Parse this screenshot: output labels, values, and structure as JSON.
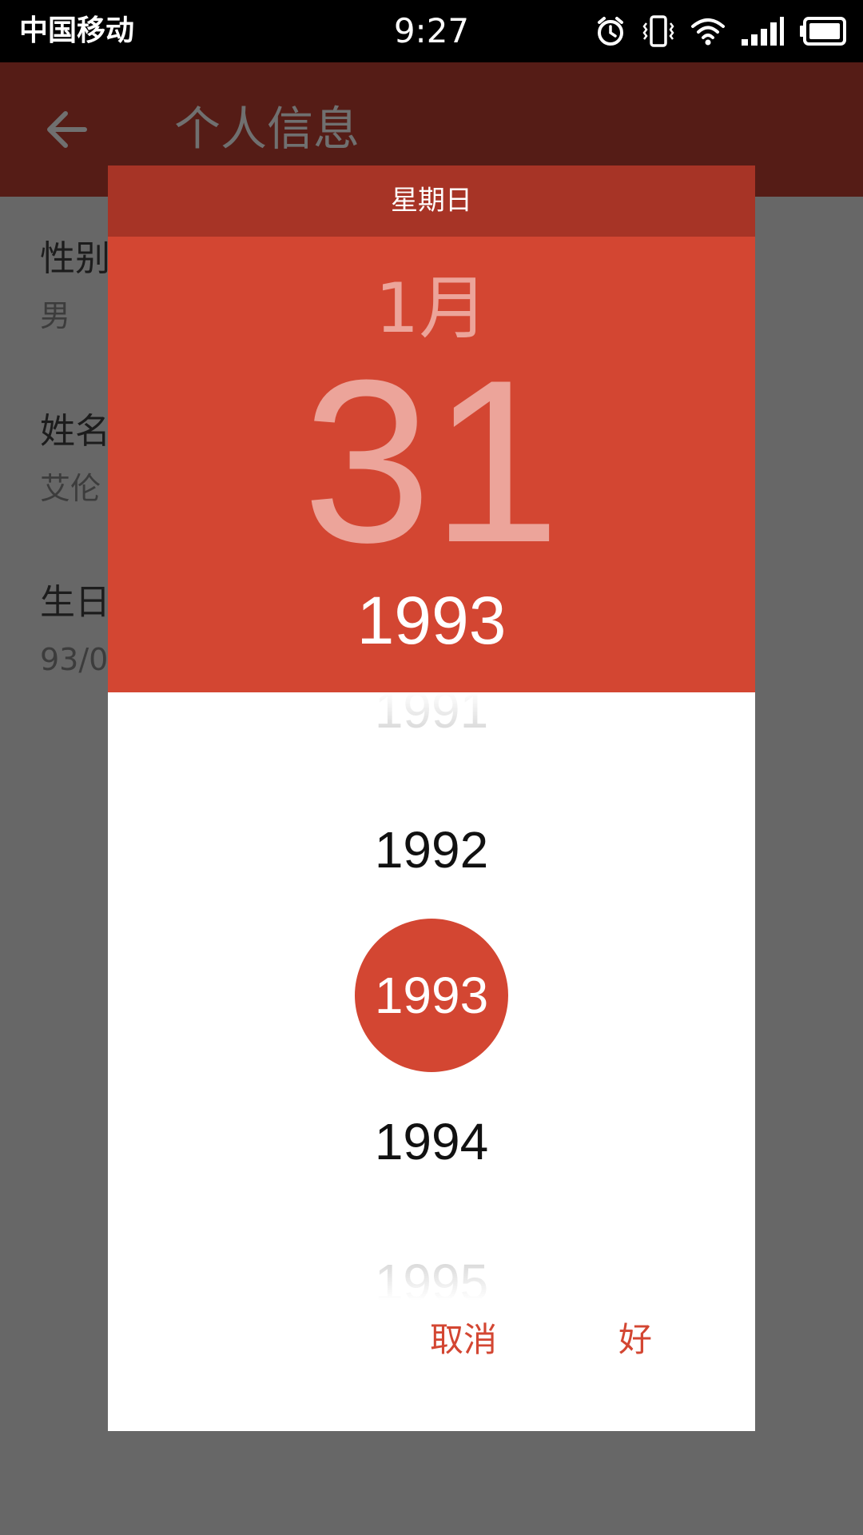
{
  "status_bar": {
    "carrier": "中国移动",
    "time": "9:27",
    "icons": [
      "alarm-icon",
      "vibrate-icon",
      "wifi-icon",
      "signal-icon",
      "battery-icon"
    ]
  },
  "app_bar": {
    "title": "个人信息",
    "back_icon": "arrow-left-icon"
  },
  "profile": {
    "items": [
      {
        "label": "性别",
        "value": "男"
      },
      {
        "label": "姓名",
        "value": "艾伦"
      },
      {
        "label": "生日",
        "value": "93/0"
      }
    ]
  },
  "date_picker": {
    "weekday": "星期日",
    "month": "1月",
    "day": "31",
    "year": "1993",
    "years": [
      "1991",
      "1992",
      "1993",
      "1994",
      "1995"
    ],
    "selected_year": "1993",
    "cancel_label": "取消",
    "ok_label": "好"
  },
  "colors": {
    "accent": "#d34632",
    "weekday_bar": "#a73426",
    "app_bar_dimmed": "#551c16",
    "scrim": "#676767"
  }
}
